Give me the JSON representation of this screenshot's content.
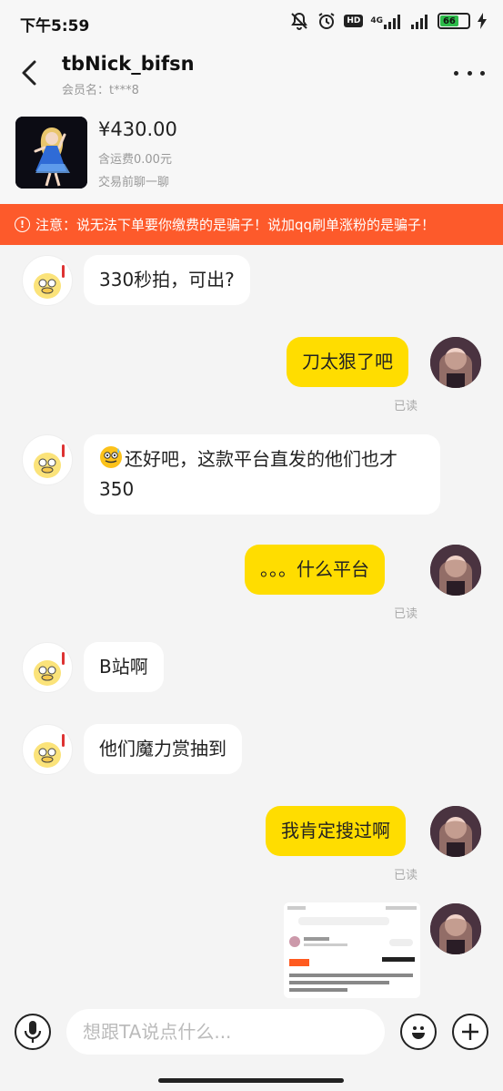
{
  "status_bar": {
    "time": "下午5:59",
    "hd_label": "HD",
    "network": "4G",
    "battery": "66",
    "icons": [
      "mute-icon",
      "alarm-icon",
      "hd-icon",
      "signal-icon",
      "signal-icon",
      "battery-icon",
      "charging-icon"
    ]
  },
  "header": {
    "title": "tbNick_bifsn",
    "member_label": "会员名：t***8"
  },
  "product": {
    "price": "¥430.00",
    "shipping": "含运费0.00元",
    "chat_prompt": "交易前聊一聊"
  },
  "warning": {
    "text": "注意：说无法下单要你缴费的是骗子！说加qq刷单涨粉的是骗子！"
  },
  "messages": [
    {
      "side": "left",
      "text": "330秒拍，可出?"
    },
    {
      "side": "right",
      "text": "刀太狠了吧",
      "status": "已读"
    },
    {
      "side": "left",
      "emoji": "grimacing-sweat-emoji",
      "text": "还好吧，这款平台直发的他们也才350"
    },
    {
      "side": "right",
      "text": "。。。什么平台",
      "status": "已读"
    },
    {
      "side": "left",
      "text": "B站啊"
    },
    {
      "side": "left",
      "text": "他们魔力赏抽到"
    },
    {
      "side": "right",
      "text": "我肯定搜过啊",
      "status": "已读"
    },
    {
      "side": "right",
      "type": "image-screenshot"
    }
  ],
  "input": {
    "placeholder": "想跟TA说点什么..."
  },
  "colors": {
    "accent_yellow": "#ffdd00",
    "warning_orange": "#fd5a2b",
    "background": "#f4f4f4"
  }
}
